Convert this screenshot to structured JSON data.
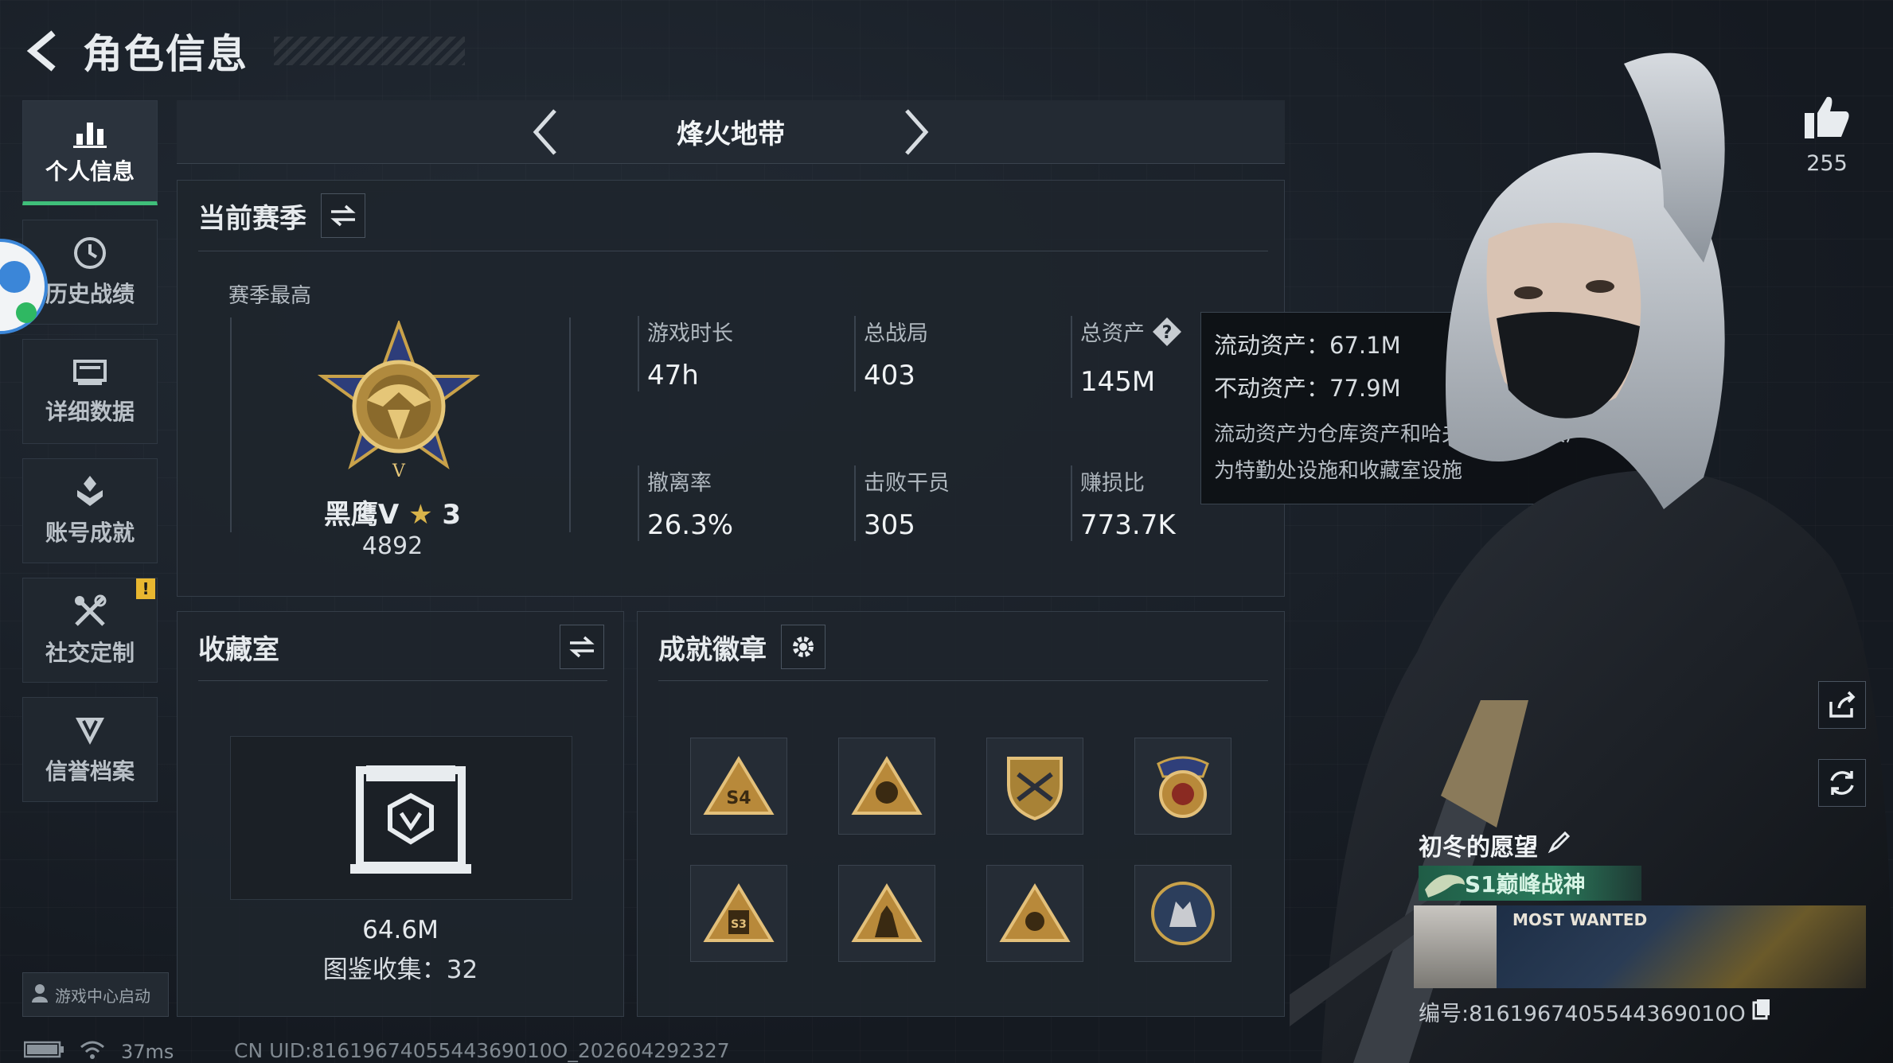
{
  "header": {
    "title": "角色信息"
  },
  "sidebar": {
    "items": [
      {
        "label": "个人信息",
        "icon": "bar-chart-icon",
        "active": true
      },
      {
        "label": "历史战绩",
        "icon": "clock-icon"
      },
      {
        "label": "详细数据",
        "icon": "stack-icon"
      },
      {
        "label": "账号成就",
        "icon": "achievement-icon"
      },
      {
        "label": "社交定制",
        "icon": "tools-icon",
        "badge": "!"
      },
      {
        "label": "信誉档案",
        "icon": "shield-icon"
      }
    ],
    "game_center": "游戏中心启动"
  },
  "mode": {
    "title": "烽火地带"
  },
  "season": {
    "title": "当前赛季",
    "best_label": "赛季最高",
    "rank_name": "黑鹰V",
    "rank_stars": "3",
    "rank_score": "4892",
    "stats": [
      {
        "label": "游戏时长",
        "value": "47h"
      },
      {
        "label": "总战局",
        "value": "403"
      },
      {
        "label": "总资产",
        "value": "145M"
      },
      {
        "label": "撤离率",
        "value": "26.3%"
      },
      {
        "label": "击败干员",
        "value": "305"
      },
      {
        "label": "赚损比",
        "value": "773.7K"
      }
    ]
  },
  "tooltip": {
    "liquid": "流动资产：67.1M",
    "fixed": "不动资产：77.9M",
    "note_line1": "流动资产为仓库资产和哈夫币，不动资产",
    "note_line2": "为特勤处设施和收藏室设施"
  },
  "collection": {
    "title": "收藏室",
    "value": "64.6M",
    "count": "图鉴收集：32"
  },
  "badges": {
    "title": "成就徽章"
  },
  "profile": {
    "likes": "255",
    "player_name": "初冬的愿望",
    "title_badge": "S1巅峰战神",
    "card_text": "MOST WANTED",
    "uid": "编号:8161967405544369010O"
  },
  "status": {
    "ping": "37ms",
    "cn_uid": "CN UID:8161967405544369010O_202604292327"
  },
  "colors": {
    "accent_green": "#3fbf7a",
    "warning": "#e8b730",
    "gold": "#c9a24a"
  }
}
